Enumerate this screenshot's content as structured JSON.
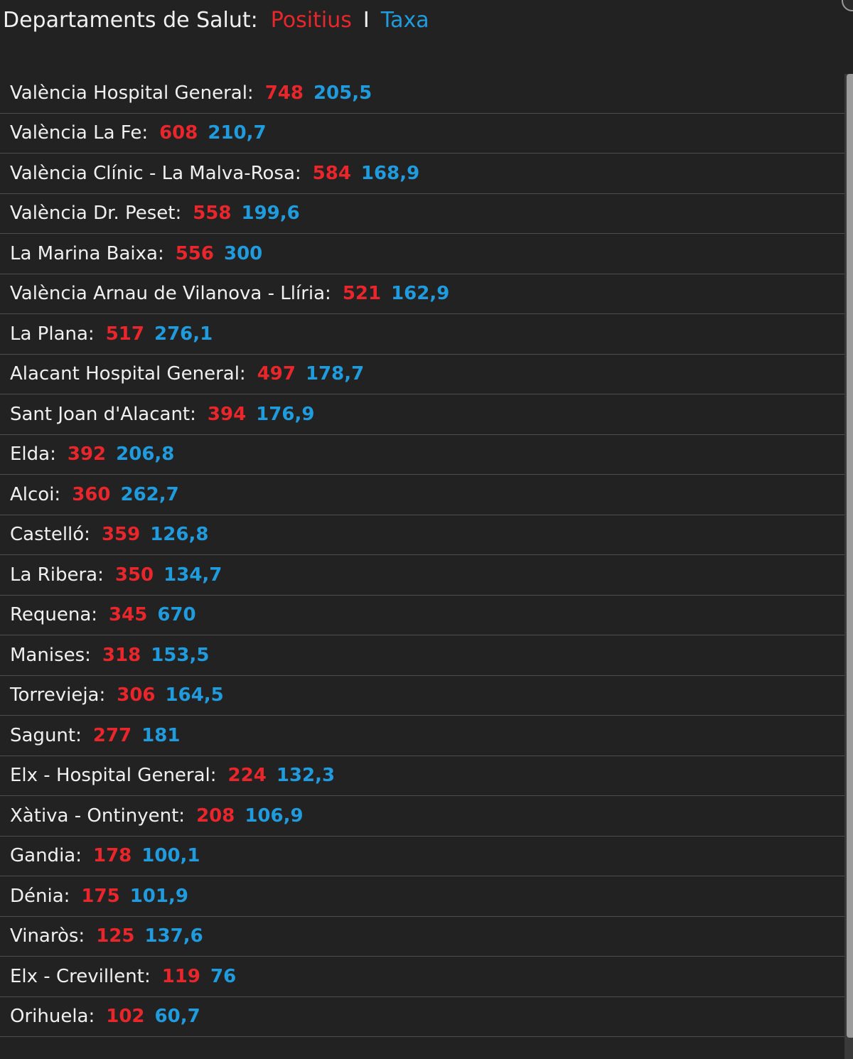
{
  "header": {
    "title": "Departaments de Salut:",
    "positius_label": "Positius",
    "separator": "I",
    "taxa_label": "Taxa"
  },
  "colors": {
    "background": "#222222",
    "positius": "#e8262b",
    "taxa": "#1f9bde",
    "text": "#f0f0f0"
  },
  "rows": [
    {
      "name": "València Hospital General:",
      "positius": "748",
      "taxa": "205,5"
    },
    {
      "name": "València La Fe:",
      "positius": "608",
      "taxa": "210,7"
    },
    {
      "name": "València Clínic - La Malva-Rosa:",
      "positius": "584",
      "taxa": "168,9"
    },
    {
      "name": "València Dr. Peset:",
      "positius": "558",
      "taxa": "199,6"
    },
    {
      "name": "La Marina Baixa:",
      "positius": "556",
      "taxa": "300"
    },
    {
      "name": "València Arnau de Vilanova - Llíria:",
      "positius": "521",
      "taxa": "162,9"
    },
    {
      "name": "La Plana:",
      "positius": "517",
      "taxa": "276,1"
    },
    {
      "name": "Alacant Hospital General:",
      "positius": "497",
      "taxa": "178,7"
    },
    {
      "name": "Sant Joan d'Alacant:",
      "positius": "394",
      "taxa": "176,9"
    },
    {
      "name": "Elda:",
      "positius": "392",
      "taxa": "206,8"
    },
    {
      "name": "Alcoi:",
      "positius": "360",
      "taxa": "262,7"
    },
    {
      "name": "Castelló:",
      "positius": "359",
      "taxa": "126,8"
    },
    {
      "name": "La Ribera:",
      "positius": "350",
      "taxa": "134,7"
    },
    {
      "name": "Requena:",
      "positius": "345",
      "taxa": "670"
    },
    {
      "name": "Manises:",
      "positius": "318",
      "taxa": "153,5"
    },
    {
      "name": "Torrevieja:",
      "positius": "306",
      "taxa": "164,5"
    },
    {
      "name": "Sagunt:",
      "positius": "277",
      "taxa": "181"
    },
    {
      "name": "Elx - Hospital General:",
      "positius": "224",
      "taxa": "132,3"
    },
    {
      "name": "Xàtiva - Ontinyent:",
      "positius": "208",
      "taxa": "106,9"
    },
    {
      "name": "Gandia:",
      "positius": "178",
      "taxa": "100,1"
    },
    {
      "name": "Dénia:",
      "positius": "175",
      "taxa": "101,9"
    },
    {
      "name": "Vinaròs:",
      "positius": "125",
      "taxa": "137,6"
    },
    {
      "name": "Elx - Crevillent:",
      "positius": "119",
      "taxa": "76"
    },
    {
      "name": "Orihuela:",
      "positius": "102",
      "taxa": "60,7"
    }
  ]
}
